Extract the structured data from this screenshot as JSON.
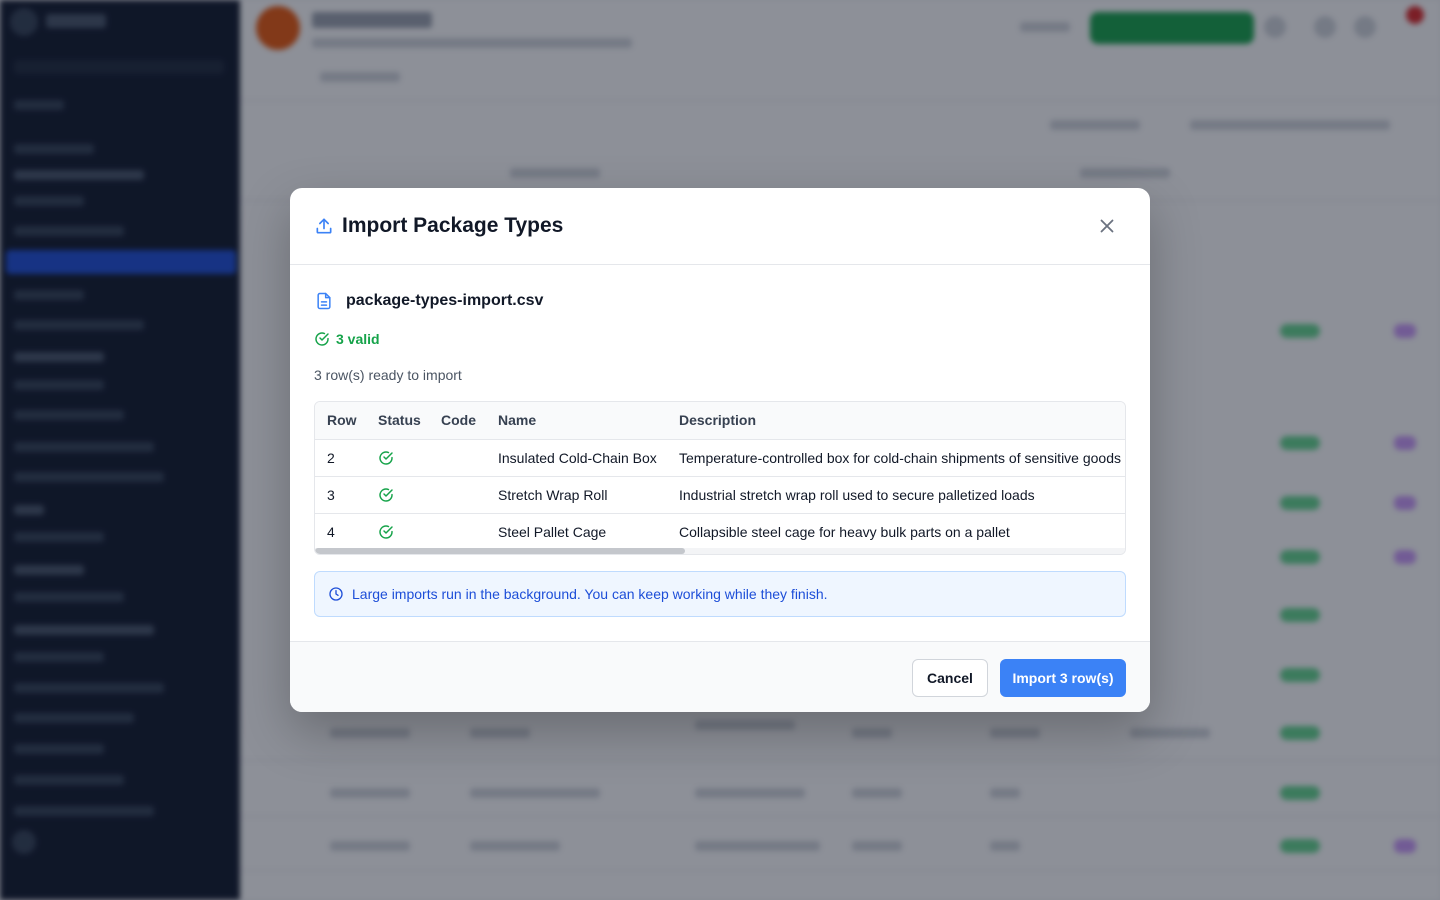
{
  "modal": {
    "title": "Import Package Types",
    "file_name": "package-types-import.csv",
    "valid_count_label": "3 valid",
    "ready_text": "3 row(s) ready to import",
    "table": {
      "columns": [
        "Row",
        "Status",
        "Code",
        "Name",
        "Description"
      ],
      "rows": [
        {
          "row": "2",
          "status": "valid",
          "code": "",
          "name": "Insulated Cold-Chain Box",
          "description": "Temperature-controlled box for cold-chain shipments of sensitive goods"
        },
        {
          "row": "3",
          "status": "valid",
          "code": "",
          "name": "Stretch Wrap Roll",
          "description": "Industrial stretch wrap roll used to secure palletized loads"
        },
        {
          "row": "4",
          "status": "valid",
          "code": "",
          "name": "Steel Pallet Cage",
          "description": "Collapsible steel cage for heavy bulk parts on a pallet"
        }
      ]
    },
    "info_text": "Large imports run in the background. You can keep working while they finish.",
    "cancel_label": "Cancel",
    "import_label": "Import 3 row(s)"
  },
  "icons": {
    "title": "upload-icon",
    "file": "file-text-icon",
    "valid": "check-circle-icon",
    "info": "clock-icon",
    "close": "close-icon"
  },
  "colors": {
    "accent": "#3b82f6",
    "success": "#16a34a",
    "info_text": "#1d4ed8",
    "info_bg": "#eff6ff",
    "sidebar_bg": "#0f172a"
  }
}
